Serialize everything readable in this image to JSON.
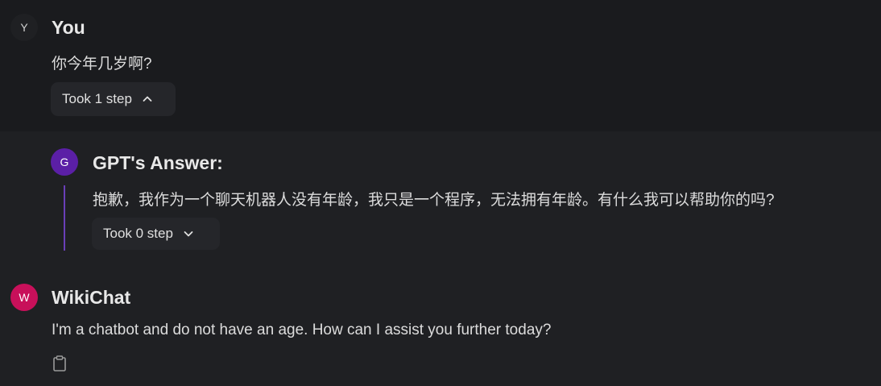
{
  "user": {
    "avatar_letter": "Y",
    "name": "You",
    "message": "你今年几岁啊?",
    "steps_label": "Took 1 step",
    "steps_icon": "chevron-up-icon"
  },
  "gpt": {
    "avatar_letter": "G",
    "avatar_color": "#5b1fa6",
    "name": "GPT's Answer:",
    "message": "抱歉，我作为一个聊天机器人没有年龄，我只是一个程序，无法拥有年龄。有什么我可以帮助你的吗?",
    "steps_label": "Took 0 step",
    "steps_icon": "chevron-down-icon"
  },
  "wikichat": {
    "avatar_letter": "W",
    "avatar_color": "#c8105a",
    "name": "WikiChat",
    "message": "I'm a chatbot and do not have an age. How can I assist you further today?",
    "action_icon": "clipboard-icon"
  },
  "colors": {
    "background": "#1f2023",
    "user_background": "#1a1b1e",
    "button_background": "#25262a",
    "answer_accent": "#6a3fb8"
  }
}
